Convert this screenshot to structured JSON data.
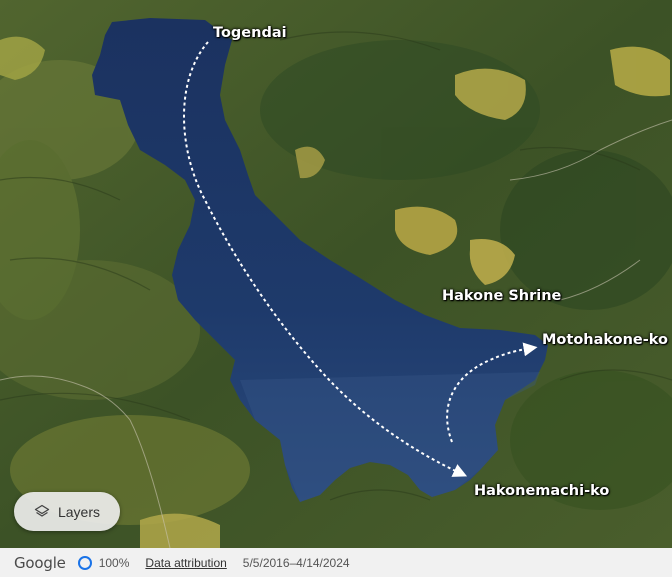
{
  "map": {
    "places": [
      {
        "id": "togendai",
        "name": "Togendai"
      },
      {
        "id": "hakone-shrine",
        "name": "Hakone Shrine"
      },
      {
        "id": "motohakone-ko",
        "name": "Motohakone-ko"
      },
      {
        "id": "hakonemachi-ko",
        "name": "Hakonemachi-ko"
      }
    ],
    "routes": [
      {
        "from": "Togendai",
        "to": "Hakonemachi-ko",
        "style": "dotted-arrow",
        "color": "#ffffff"
      },
      {
        "from": "Hakonemachi-ko",
        "to": "Motohakone-ko",
        "style": "dotted-arrow",
        "color": "#ffffff"
      }
    ],
    "colors": {
      "lake": "#1f3a66",
      "forest": "#3f5a2a",
      "route": "#ffffff"
    }
  },
  "controls": {
    "layers_label": "Layers",
    "layers_icon": "layers-icon"
  },
  "footer": {
    "brand": "Google",
    "zoom": "100%",
    "attribution": "Data attribution",
    "date_range": "5/5/2016–4/14/2024"
  }
}
